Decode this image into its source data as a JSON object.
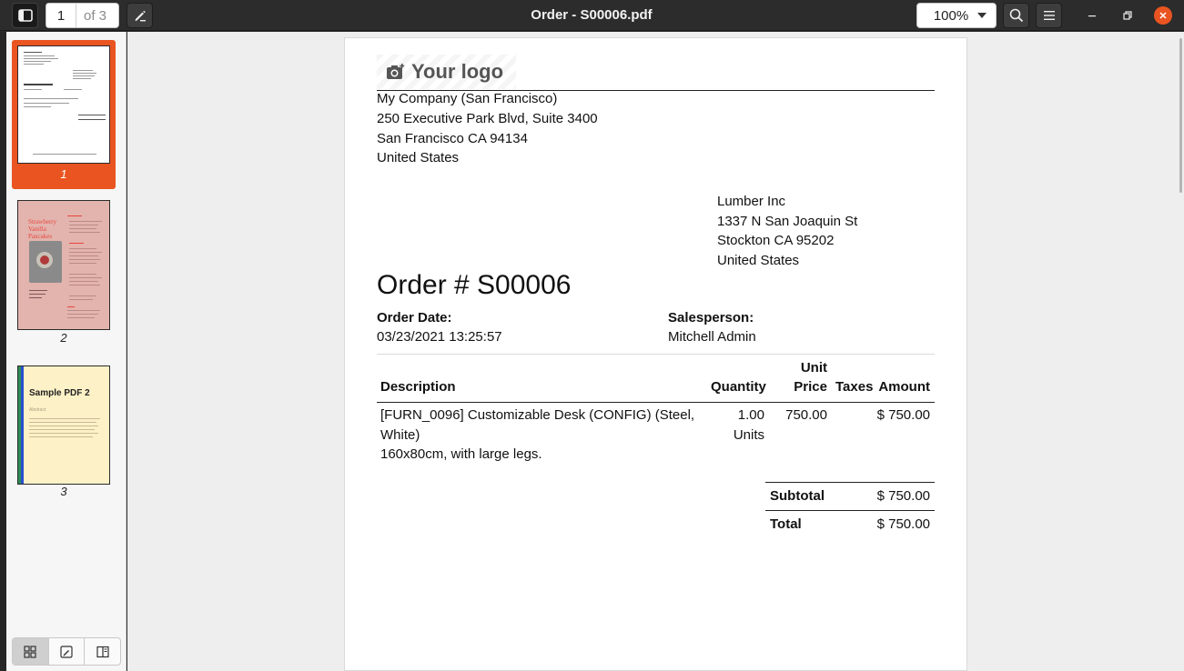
{
  "header": {
    "page_current": "1",
    "page_of": "of 3",
    "title": "Order - S00006.pdf",
    "zoom": "100%"
  },
  "sidebar": {
    "thumbs": [
      {
        "number": "1"
      },
      {
        "number": "2",
        "title": "Strawberry Vanilla Pancakes"
      },
      {
        "number": "3",
        "title": "Sample PDF 2",
        "subtitle": "Abstract"
      }
    ]
  },
  "document": {
    "logo": "Your logo",
    "company": {
      "name": "My Company (San Francisco)",
      "street": "250 Executive Park Blvd, Suite 3400",
      "city": "San Francisco CA 94134",
      "country": "United States"
    },
    "customer": {
      "name": "Lumber Inc",
      "street": "1337 N San Joaquin St",
      "city": "Stockton CA 95202",
      "country": "United States"
    },
    "order_title": "Order # S00006",
    "order_date_label": "Order Date:",
    "order_date": "03/23/2021 13:25:57",
    "salesperson_label": "Salesperson:",
    "salesperson": "Mitchell Admin",
    "table": {
      "headers": {
        "description": "Description",
        "quantity": "Quantity",
        "unit_price_1": "Unit",
        "unit_price_2": "Price",
        "taxes": "Taxes",
        "amount": "Amount"
      },
      "rows": [
        {
          "description_1": "[FURN_0096] Customizable Desk (CONFIG) (Steel,",
          "description_2": "White)",
          "description_3": "160x80cm, with large legs.",
          "quantity": "1.00",
          "uom": "Units",
          "unit_price": "750.00",
          "taxes": "",
          "amount": "$ 750.00"
        }
      ]
    },
    "totals": {
      "subtotal_label": "Subtotal",
      "subtotal": "$ 750.00",
      "total_label": "Total",
      "total": "$ 750.00"
    }
  },
  "colors": {
    "accent": "#e95420",
    "header_bg": "#2c2c2c",
    "viewer_bg": "#eeeeee"
  }
}
